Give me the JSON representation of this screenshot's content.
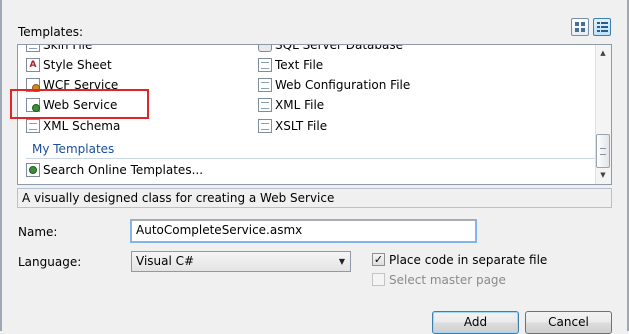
{
  "templates_label": "Templates:",
  "view_toggles": {
    "large_icons": "large-icons-view",
    "small_icons": "small-icons-view",
    "active": "small_icons"
  },
  "templates": {
    "left_column": [
      {
        "label": "Skin File",
        "icon": "skin-file-icon",
        "clipped": true
      },
      {
        "label": "Style Sheet",
        "icon": "style-sheet-icon"
      },
      {
        "label": "WCF Service",
        "icon": "wcf-service-icon",
        "clipped": true
      },
      {
        "label": "Web Service",
        "icon": "web-service-icon",
        "highlighted": true
      },
      {
        "label": "XML Schema",
        "icon": "xml-schema-icon"
      }
    ],
    "right_column": [
      {
        "label": "SQL Server Database",
        "icon": "database-icon",
        "clipped": true
      },
      {
        "label": "Text File",
        "icon": "text-file-icon"
      },
      {
        "label": "Web Configuration File",
        "icon": "web-config-icon"
      },
      {
        "label": "XML File",
        "icon": "xml-file-icon"
      },
      {
        "label": "XSLT File",
        "icon": "xslt-file-icon"
      }
    ],
    "my_templates_header": "My Templates",
    "search_online": "Search Online Templates..."
  },
  "description": "A visually designed class for creating a Web Service",
  "name": {
    "label": "Name:",
    "value": "AutoCompleteService.asmx"
  },
  "language": {
    "label": "Language:",
    "selected": "Visual C#"
  },
  "options": {
    "place_code_separate": {
      "label": "Place code in separate file",
      "checked": true
    },
    "select_master_page": {
      "label": "Select master page",
      "checked": false,
      "disabled": true
    }
  },
  "buttons": {
    "add": "Add",
    "cancel": "Cancel"
  },
  "colors": {
    "highlight": "#e0242a",
    "section_header": "#1a4e9c"
  }
}
